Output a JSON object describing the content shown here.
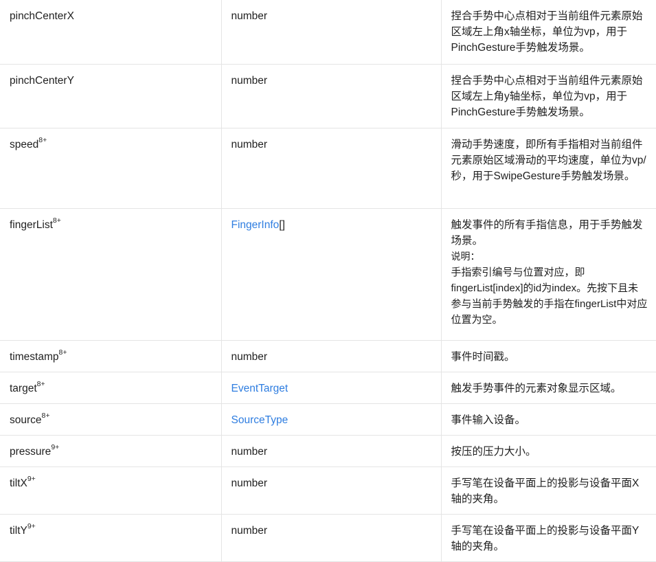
{
  "rows": [
    {
      "name": "pinchCenterX",
      "since": "",
      "type": "number",
      "type_is_link": false,
      "type_suffix": "",
      "desc": "捏合手势中心点相对于当前组件元素原始区域左上角x轴坐标，单位为vp，用于PinchGesture手势触发场景。"
    },
    {
      "name": "pinchCenterY",
      "since": "",
      "type": "number",
      "type_is_link": false,
      "type_suffix": "",
      "desc": "捏合手势中心点相对于当前组件元素原始区域左上角y轴坐标，单位为vp，用于PinchGesture手势触发场景。"
    },
    {
      "name": "speed",
      "since": "8+",
      "type": "number",
      "type_is_link": false,
      "type_suffix": "",
      "desc": "滑动手势速度，即所有手指相对当前组件元素原始区域滑动的平均速度，单位为vp/秒，用于SwipeGesture手势触发场景。"
    },
    {
      "name": "fingerList",
      "since": "8+",
      "type": "FingerInfo",
      "type_is_link": true,
      "type_suffix": "[]",
      "desc": "触发事件的所有手指信息，用于手势触发场景。",
      "note_label": "说明：",
      "note_body": "手指索引编号与位置对应，即fingerList[index]的id为index。先按下且未参与当前手势触发的手指在fingerList中对应位置为空。"
    },
    {
      "name": "timestamp",
      "since": "8+",
      "type": "number",
      "type_is_link": false,
      "type_suffix": "",
      "desc": "事件时间戳。"
    },
    {
      "name": "target",
      "since": "8+",
      "type": "EventTarget",
      "type_is_link": true,
      "type_suffix": "",
      "desc": "触发手势事件的元素对象显示区域。"
    },
    {
      "name": "source",
      "since": "8+",
      "type": "SourceType",
      "type_is_link": true,
      "type_suffix": "",
      "desc": "事件输入设备。"
    },
    {
      "name": "pressure",
      "since": "9+",
      "type": "number",
      "type_is_link": false,
      "type_suffix": "",
      "desc": "按压的压力大小。"
    },
    {
      "name": "tiltX",
      "since": "9+",
      "type": "number",
      "type_is_link": false,
      "type_suffix": "",
      "desc": "手写笔在设备平面上的投影与设备平面X轴的夹角。"
    },
    {
      "name": "tiltY",
      "since": "9+",
      "type": "number",
      "type_is_link": false,
      "type_suffix": "",
      "desc": "手写笔在设备平面上的投影与设备平面Y轴的夹角。"
    }
  ],
  "colors": {
    "link": "#2e7de0",
    "border": "#e4e4e4",
    "text": "#1f1f1f"
  }
}
